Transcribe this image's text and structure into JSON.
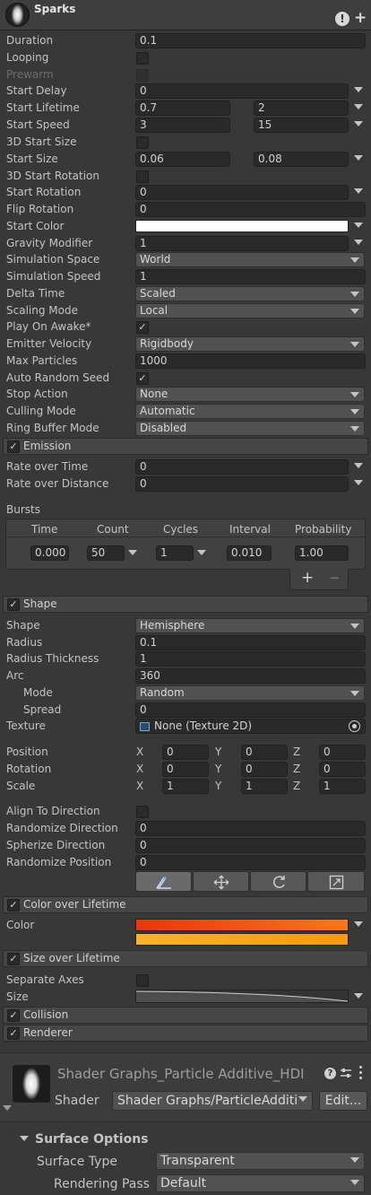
{
  "header": {
    "title": "Sparks"
  },
  "main": [
    {
      "label": "Duration",
      "value": "0.1"
    },
    {
      "label": "Looping"
    },
    {
      "label": "Prewarm"
    },
    {
      "label": "Start Delay",
      "value": "0"
    },
    {
      "label": "Start Lifetime",
      "min": "0.7",
      "max": "2"
    },
    {
      "label": "Start Speed",
      "min": "3",
      "max": "15"
    },
    {
      "label": "3D Start Size"
    },
    {
      "label": "Start Size",
      "min": "0.06",
      "max": "0.08"
    },
    {
      "label": "3D Start Rotation"
    },
    {
      "label": "Start Rotation",
      "value": "0"
    },
    {
      "label": "Flip Rotation",
      "value": "0"
    },
    {
      "label": "Start Color",
      "color": "#ffffff"
    },
    {
      "label": "Gravity Modifier",
      "value": "1"
    },
    {
      "label": "Simulation Space",
      "value": "World"
    },
    {
      "label": "Simulation Speed",
      "value": "1"
    },
    {
      "label": "Delta Time",
      "value": "Scaled"
    },
    {
      "label": "Scaling Mode",
      "value": "Local"
    },
    {
      "label": "Play On Awake*",
      "checked": true
    },
    {
      "label": "Emitter Velocity",
      "value": "Rigidbody"
    },
    {
      "label": "Max Particles",
      "value": "1000"
    },
    {
      "label": "Auto Random Seed",
      "checked": true
    },
    {
      "label": "Stop Action",
      "value": "None"
    },
    {
      "label": "Culling Mode",
      "value": "Automatic"
    },
    {
      "label": "Ring Buffer Mode",
      "value": "Disabled"
    }
  ],
  "emission": {
    "title": "Emission",
    "rate_time_label": "Rate over Time",
    "rate_time": "0",
    "rate_dist_label": "Rate over Distance",
    "rate_dist": "0",
    "bursts_label": "Bursts",
    "columns": [
      "Time",
      "Count",
      "Cycles",
      "Interval",
      "Probability"
    ],
    "burst": {
      "time": "0.000",
      "count": "50",
      "cycles": "1",
      "interval": "0.010",
      "probability": "1.00"
    },
    "add": "+",
    "remove": "−"
  },
  "shape": {
    "title": "Shape",
    "shape_label": "Shape",
    "shape": "Hemisphere",
    "radius_label": "Radius",
    "radius": "0.1",
    "thick_label": "Radius Thickness",
    "thick": "1",
    "arc_label": "Arc",
    "arc": "360",
    "mode_label": "Mode",
    "mode": "Random",
    "spread_label": "Spread",
    "spread": "0",
    "texture_label": "Texture",
    "texture": "None (Texture 2D)",
    "position_label": "Position",
    "position": [
      "0",
      "0",
      "0"
    ],
    "rotation_label": "Rotation",
    "rotation": [
      "0",
      "0",
      "0"
    ],
    "scale_label": "Scale",
    "scale": [
      "1",
      "1",
      "1"
    ],
    "axes": [
      "X",
      "Y",
      "Z"
    ],
    "align_label": "Align To Direction",
    "rand_dir_label": "Randomize Direction",
    "rand_dir": "0",
    "spher_label": "Spherize Direction",
    "spher": "0",
    "rand_pos_label": "Randomize Position",
    "rand_pos": "0"
  },
  "col": {
    "title": "Color over Lifetime",
    "label": "Color",
    "grad1": [
      "#e2380e",
      "#f5791c"
    ],
    "grad2": [
      "#f8b232",
      "#f49a14"
    ]
  },
  "size": {
    "title": "Size over Lifetime",
    "axes_label": "Separate Axes",
    "label": "Size"
  },
  "collision": {
    "title": "Collision"
  },
  "renderer": {
    "title": "Renderer"
  },
  "material": {
    "name": "Shader Graphs_Particle Additive_HDI",
    "shader_label": "Shader",
    "shader": "Shader Graphs/ParticleAdditi",
    "edit": "Edit..."
  },
  "surface": {
    "title": "Surface Options",
    "type_label": "Surface Type",
    "type": "Transparent",
    "pass_label": "Rendering Pass",
    "pass": "Default"
  },
  "colors": {
    "accent": "#e2380e",
    "panel": "#383838"
  }
}
